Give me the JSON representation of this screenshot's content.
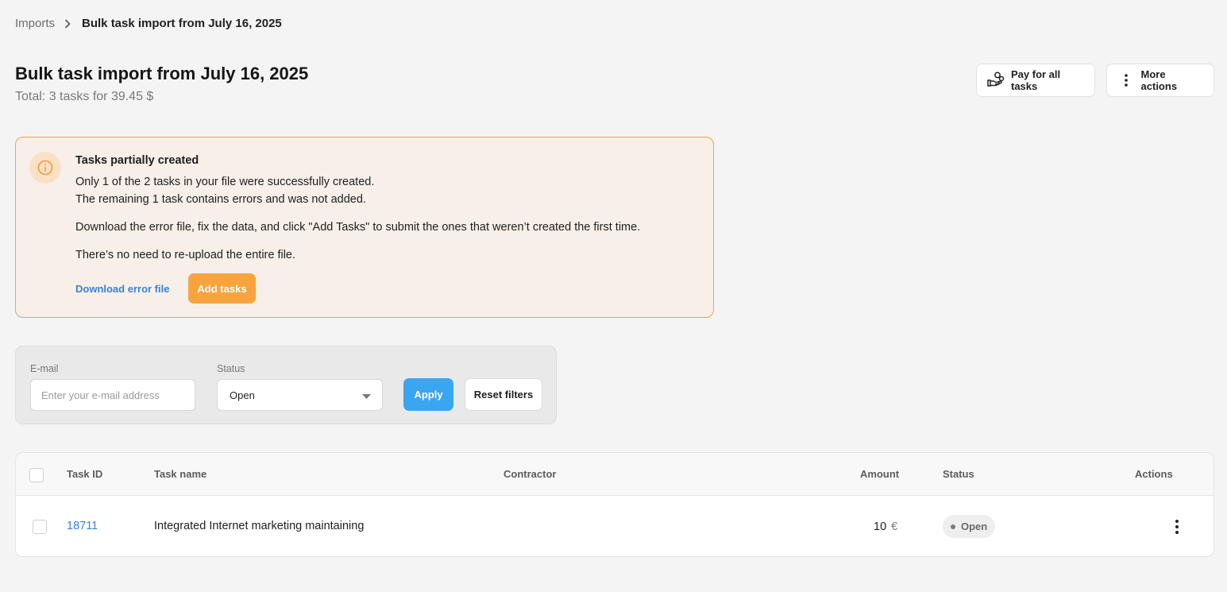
{
  "breadcrumb": {
    "parent": "Imports",
    "current": "Bulk task import from July 16, 2025",
    "separator_icon": "chevron-right-icon"
  },
  "header": {
    "title": "Bulk task import from July 16, 2025",
    "subtitle": "Total: 3 tasks for 39.45 $",
    "pay_button": {
      "label": "Pay for all tasks",
      "icon": "hand-coins-icon"
    },
    "more_button": {
      "label": "More actions",
      "icon": "vertical-dots-icon"
    }
  },
  "alert": {
    "icon": "info-icon",
    "title": "Tasks partially created",
    "lines": [
      "Only 1 of the 2 tasks in your file were successfully created.",
      "The remaining 1 task contains errors and was not added.",
      "Download the error file, fix the data, and click \"Add Tasks\" to submit the ones that weren’t created the first time.",
      "There’s no need to re-upload the entire file."
    ],
    "download_link": "Download error file",
    "add_button": "Add tasks"
  },
  "filters": {
    "email_label": "E-mail",
    "email_placeholder": "Enter your e-mail address",
    "status_label": "Status",
    "status_value": "Open",
    "apply_label": "Apply",
    "reset_label": "Reset filters"
  },
  "table": {
    "columns": [
      "Task ID",
      "Task name",
      "Contractor",
      "Amount",
      "Status",
      "Actions"
    ],
    "rows": [
      {
        "task_id": "18711",
        "task_name": "Integrated Internet marketing maintaining",
        "contractor": "",
        "amount": "10",
        "currency": "€",
        "status": "Open"
      }
    ]
  },
  "colors": {
    "accent_orange": "#f7a43f",
    "alert_border": "#f3a24a",
    "apply_blue": "#3aa6f2",
    "link_blue": "#3b82d6"
  }
}
